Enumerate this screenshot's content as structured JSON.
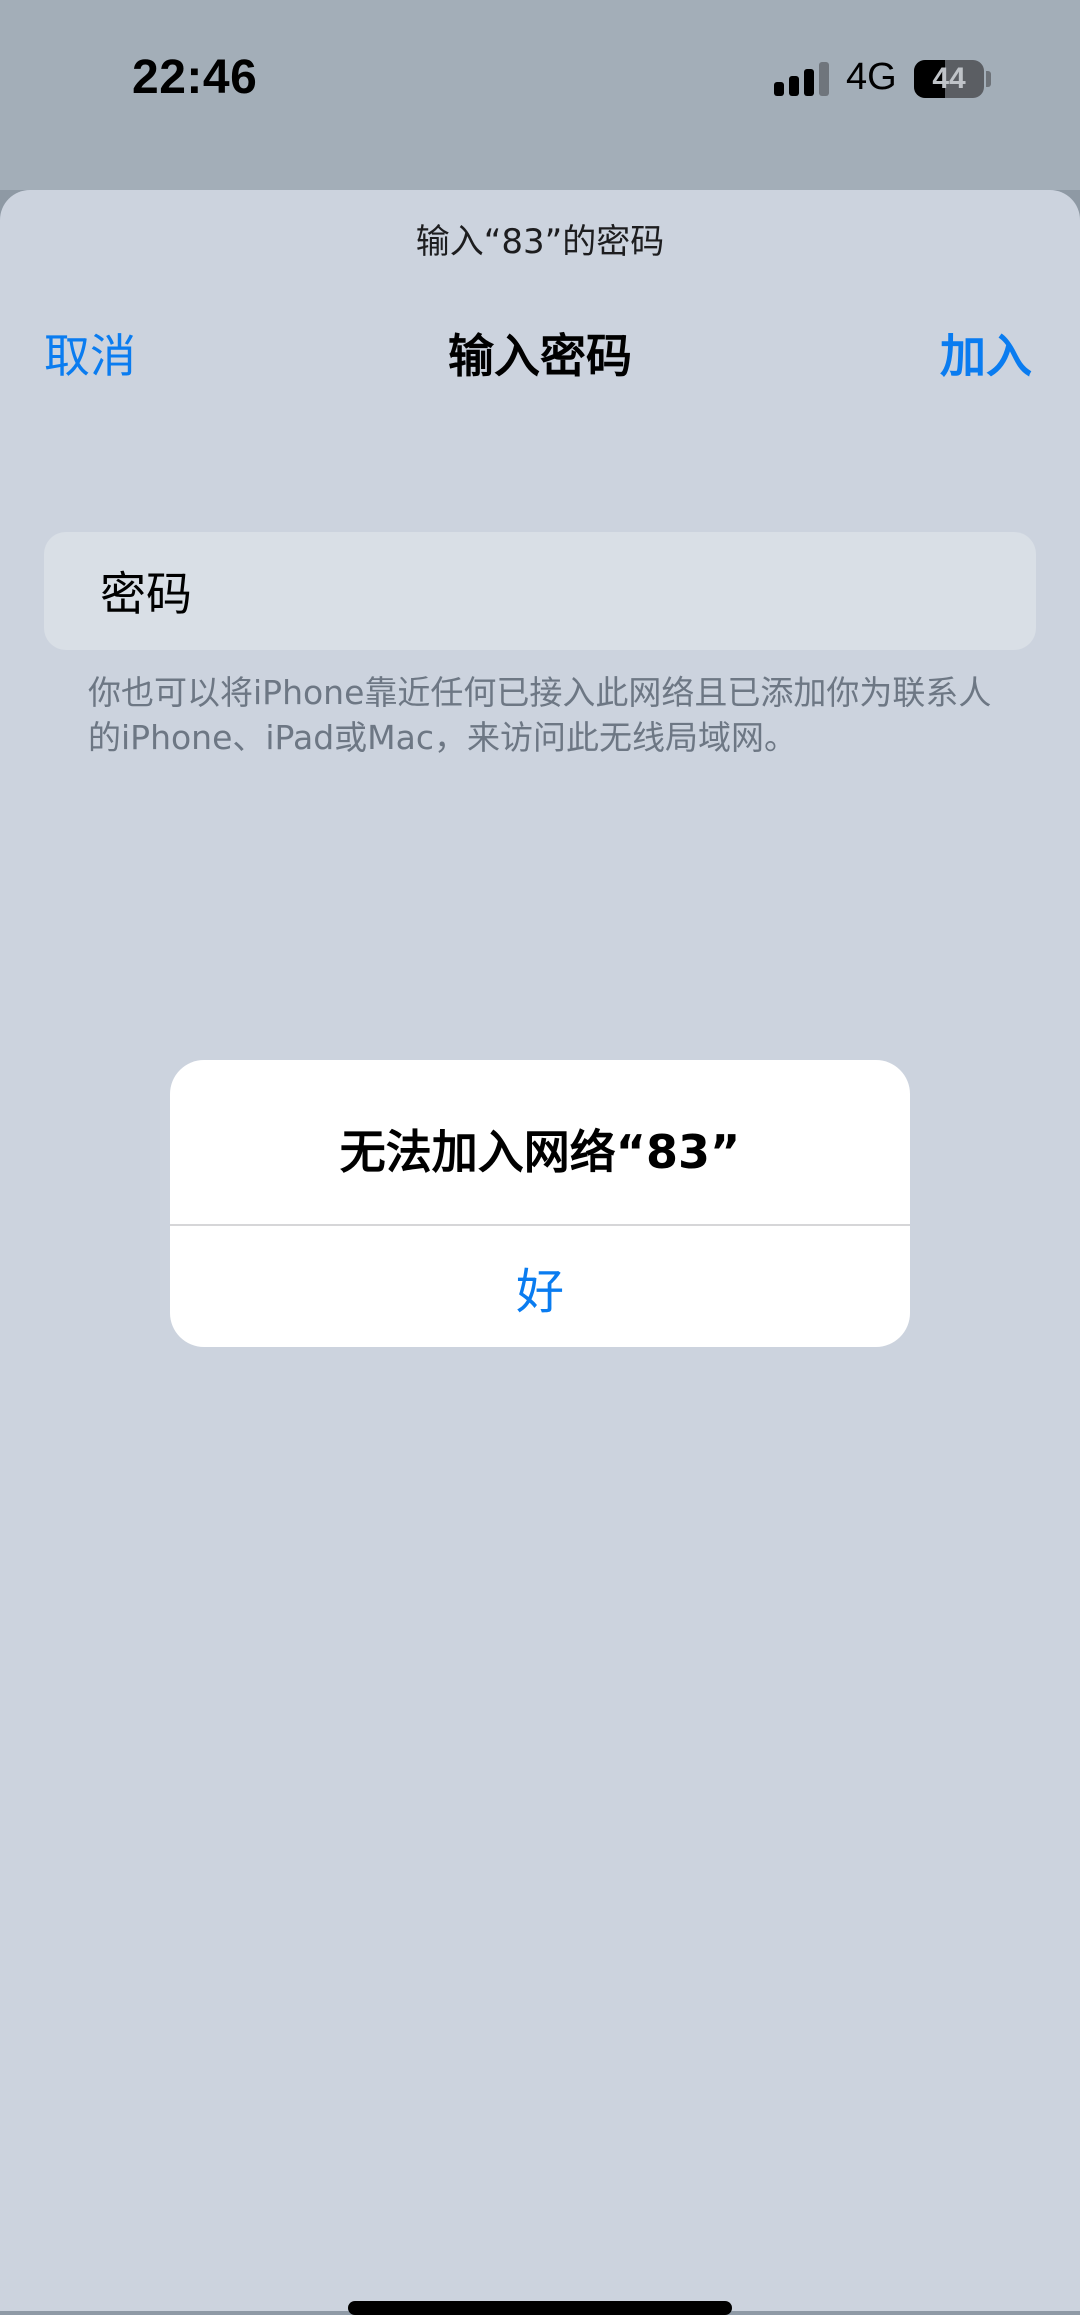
{
  "status_bar": {
    "time": "22:46",
    "network": "4G",
    "battery": "44",
    "battery_level": 0.44,
    "signal_bars": 3
  },
  "sheet": {
    "prompt": "输入“83”的密码",
    "cancel_label": "取消",
    "title": "输入密码",
    "join_label": "加入",
    "password_placeholder": "密码",
    "hint": "你也可以将iPhone靠近任何已接入此网络且已添加你为联系人的iPhone、iPad或Mac，来访问此无线局域网。"
  },
  "alert": {
    "title": "无法加入网络“83”",
    "ok_label": "好"
  },
  "colors": {
    "accent": "#0a7cf0",
    "sheet_background": "#ccd3de",
    "field_background": "#d9dfe6",
    "hint_text": "#6d7784"
  }
}
